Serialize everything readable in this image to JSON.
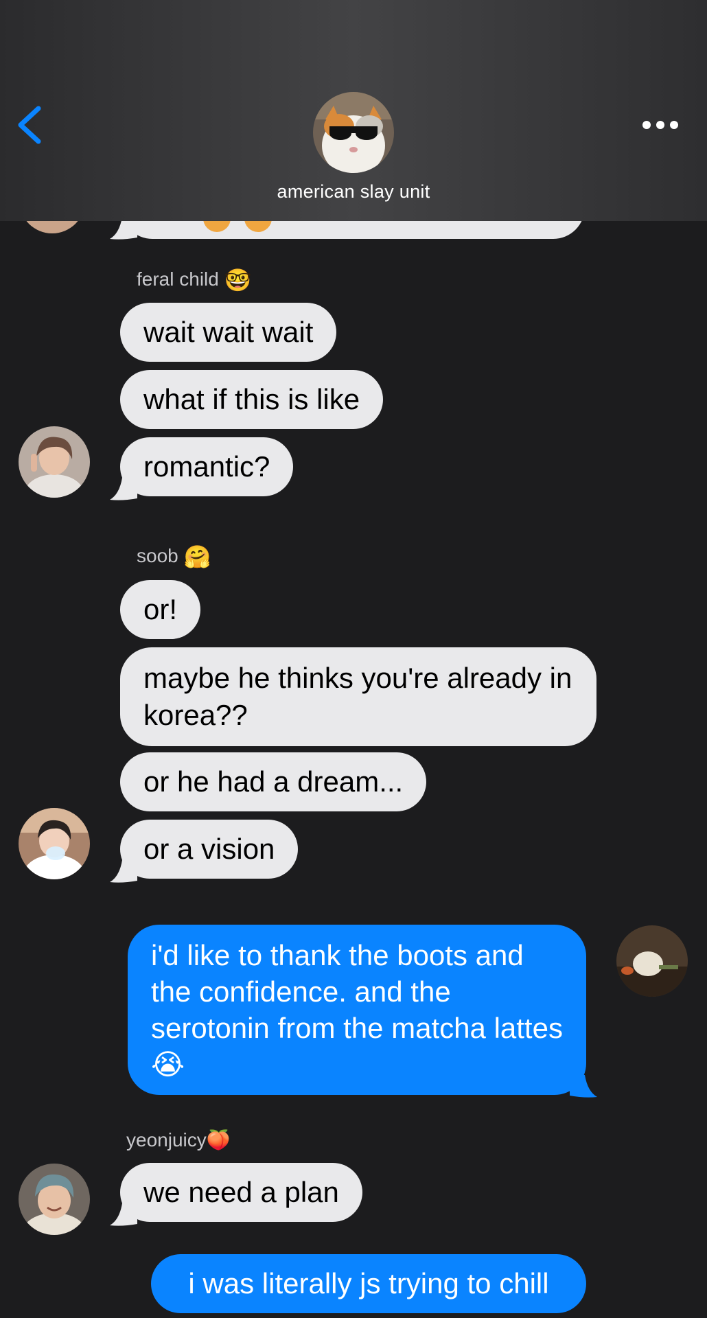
{
  "header": {
    "group_name": "american slay unit"
  },
  "messages": {
    "feral_sender": "feral child",
    "feral_emoji": "🤓",
    "m1": "wait wait wait",
    "m2": "what if this is like",
    "m3": "romantic?",
    "soob_sender": "soob",
    "soob_emoji": "🤗",
    "m4": "or!",
    "m5": "maybe he thinks you're already in korea??",
    "m6": "or he had a dream...",
    "m7": "or a vision",
    "m8": "i'd like to thank the boots and the confidence. and the serotonin from the matcha lattes😭",
    "yeon_sender": "yeonjuicy🍑",
    "m9": "we need a plan",
    "m10": "i was literally js trying to chill"
  },
  "colors": {
    "incoming_bubble": "#e9e9eb",
    "outgoing_bubble": "#0a84ff",
    "background": "#1c1c1e",
    "accent": "#0a84ff"
  },
  "icons": {
    "back": "chevron-left-icon",
    "more": "ellipsis-icon"
  }
}
